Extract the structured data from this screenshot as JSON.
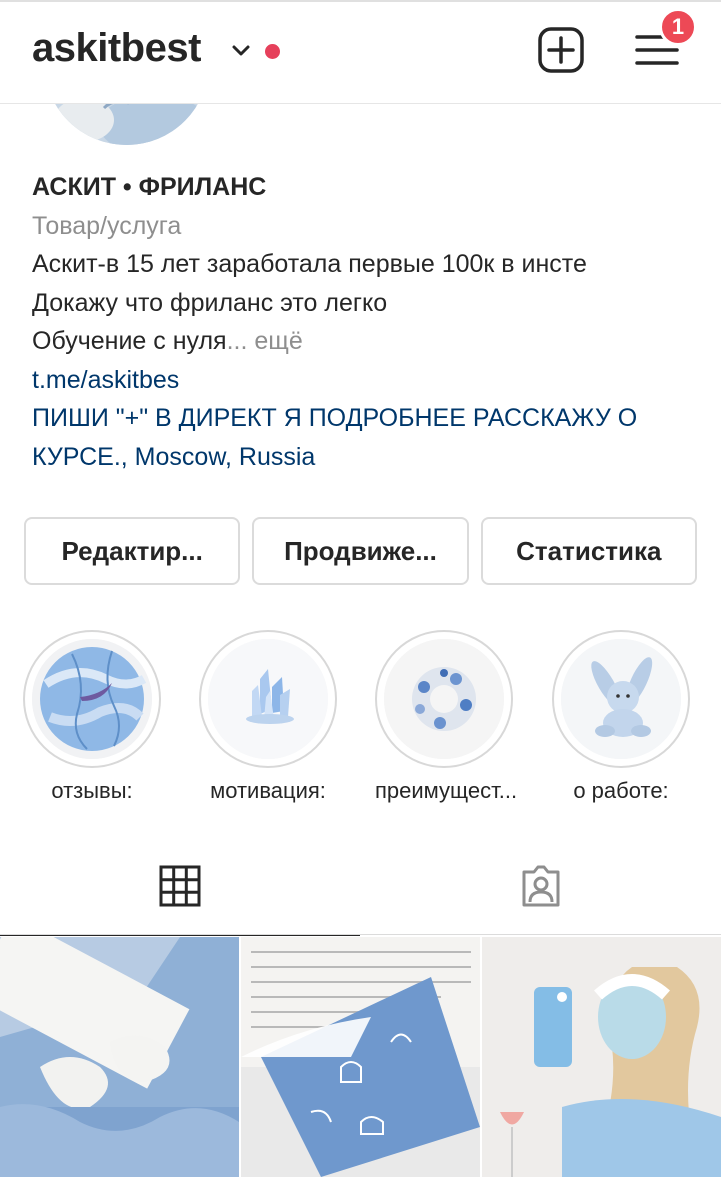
{
  "header": {
    "username": "askitbest",
    "notification_count": "1"
  },
  "profile": {
    "name": "АСКИТ • ФРИЛАНС",
    "category": "Товар/услуга",
    "bio_lines": [
      "Аскит-в 15 лет заработала первые 100к в инсте",
      "Докажу что фриланс это легко"
    ],
    "bio_truncated": "Обучение с нуля",
    "more_label": "... ещё",
    "link": "t.me/askitbes",
    "address": "ПИШИ \"+\" В ДИРЕКТ Я ПОДРОБНЕЕ РАССКАЖУ О КУРСЕ., Moscow, Russia"
  },
  "actions": {
    "edit_label": "Редактир...",
    "promote_label": "Продвиже...",
    "stats_label": "Статистика"
  },
  "highlights": [
    {
      "label": "отзывы:",
      "icon": "basketball"
    },
    {
      "label": "мотивация:",
      "icon": "crystal"
    },
    {
      "label": "преимущест...",
      "icon": "scrunchie"
    },
    {
      "label": "о работе:",
      "icon": "plush-bunny"
    }
  ],
  "tabs": [
    {
      "name": "posts-grid",
      "icon": "grid-icon"
    },
    {
      "name": "tagged",
      "icon": "tagged-person-icon"
    }
  ],
  "colors": {
    "accent_link": "#00376b",
    "badge": "#ed4956",
    "online_dot": "#e6405b"
  }
}
